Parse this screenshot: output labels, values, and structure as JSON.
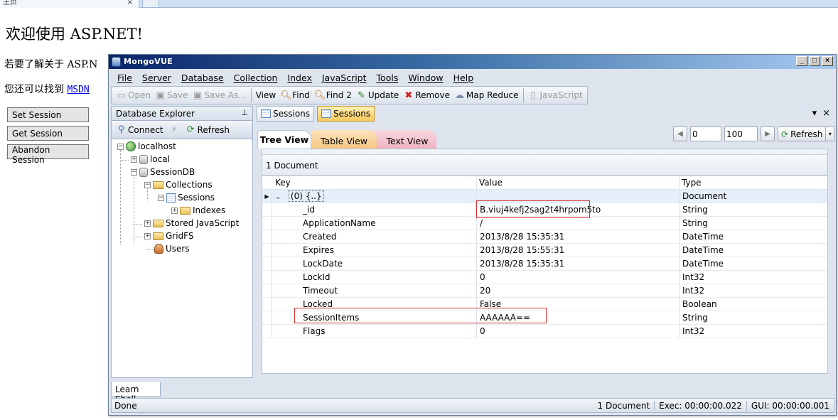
{
  "browser": {
    "tab_title": "主页",
    "tab_close": "×",
    "new_tab": "+"
  },
  "page": {
    "heading": "欢迎使用 ASP.NET!",
    "line1": "若要了解关于 ASP.N",
    "line2_prefix": "您还可以找到 ",
    "line2_link": "MSDN ",
    "buttons": {
      "set": "Set Session",
      "get": "Get Session",
      "abandon": "Abandon Session"
    }
  },
  "window": {
    "title": "MongoVUE",
    "controls": {
      "minimize": "_",
      "maximize": "□",
      "close": "×"
    },
    "menu": [
      "File",
      "Server",
      "Database",
      "Collection",
      "Index",
      "JavaScript",
      "Tools",
      "Window",
      "Help"
    ],
    "toolbar": {
      "open": "Open",
      "save": "Save",
      "save_as": "Save As...",
      "view": "View",
      "find": "Find",
      "find2": "Find 2",
      "update": "Update",
      "remove": "Remove",
      "map_reduce": "Map Reduce",
      "javascript": "JavaScript"
    },
    "explorer": {
      "title": "Database Explorer",
      "pin": "⊥",
      "connect": "Connect",
      "refresh": "Refresh",
      "nodes": {
        "localhost": "localhost",
        "local": "local",
        "sessiondb": "SessionDB",
        "collections": "Collections",
        "sessions": "Sessions",
        "indexes": "Indexes",
        "stored_js": "Stored JavaScript",
        "gridfs": "GridFS",
        "users": "Users"
      }
    },
    "doc_tabs": [
      "Sessions",
      "Sessions"
    ],
    "doc_controls": {
      "menu": "▾",
      "close": "×"
    },
    "view_tabs": {
      "tree": "Tree View",
      "table": "Table View",
      "text": "Text View"
    },
    "paging": {
      "prev": "◀",
      "skip": "0",
      "limit": "100",
      "next": "▶",
      "refresh": "Refresh",
      "dropdown": "▾"
    },
    "doc_count": "1 Document",
    "grid": {
      "headers": {
        "key": "Key",
        "value": "Value",
        "type": "Type"
      },
      "root": {
        "expander": "⌄",
        "key": "(0) {..}",
        "value": "",
        "type": "Document"
      },
      "rows": [
        {
          "key": "_id",
          "value": "B.viuj4kefj2sag2t4hrpom5to",
          "type": "String"
        },
        {
          "key": "ApplicationName",
          "value": "/",
          "type": "String"
        },
        {
          "key": "Created",
          "value": "2013/8/28 15:35:31",
          "type": "DateTime"
        },
        {
          "key": "Expires",
          "value": "2013/8/28 15:55:31",
          "type": "DateTime"
        },
        {
          "key": "LockDate",
          "value": "2013/8/28 15:35:31",
          "type": "DateTime"
        },
        {
          "key": "LockId",
          "value": "0",
          "type": "Int32"
        },
        {
          "key": "Timeout",
          "value": "20",
          "type": "Int32"
        },
        {
          "key": "Locked",
          "value": "False",
          "type": "Boolean"
        },
        {
          "key": "SessionItems",
          "value": "AAAAAA==",
          "type": "String"
        },
        {
          "key": "Flags",
          "value": "0",
          "type": "Int32"
        }
      ]
    },
    "learn_shell": "Learn Shell",
    "status": {
      "left": "Done",
      "docs": "1 Document",
      "exec": "Exec:  00:00:00.022",
      "gui": "GUI:  00:00:00.001"
    }
  },
  "colors": {
    "highlight": "#d93030",
    "title_start": "#0a246a",
    "title_end": "#a6caf0",
    "active_tab": "#f7c85c"
  }
}
